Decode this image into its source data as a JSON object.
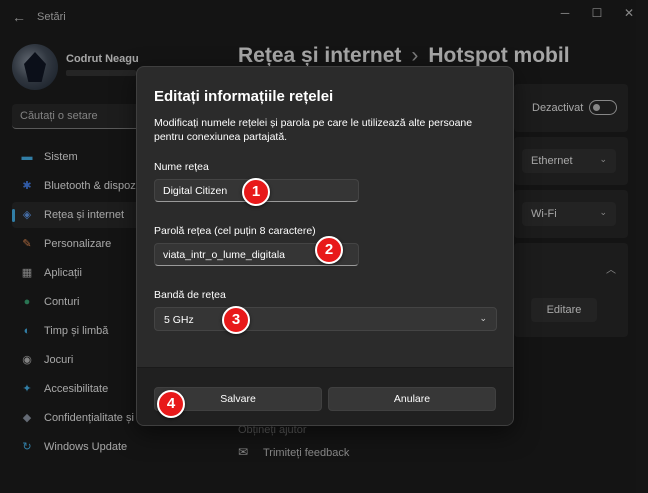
{
  "window": {
    "title": "Setări",
    "back_glyph": "←",
    "minimize_glyph": "─",
    "maximize_glyph": "☐",
    "close_glyph": "✕"
  },
  "profile": {
    "name": "Codrut Neagu"
  },
  "search": {
    "placeholder": "Căutați o setare"
  },
  "sidebar": {
    "items": [
      {
        "label": "Sistem",
        "icon": "monitor-icon",
        "glyph": "▬",
        "color": "#4cc2ff"
      },
      {
        "label": "Bluetooth & dispozi",
        "icon": "bluetooth-icon",
        "glyph": "✱",
        "color": "#4c8dff"
      },
      {
        "label": "Rețea și internet",
        "icon": "wifi-icon",
        "glyph": "◈",
        "color": "#6aa8ff",
        "active": true
      },
      {
        "label": "Personalizare",
        "icon": "brush-icon",
        "glyph": "✎",
        "color": "#ff9a5a"
      },
      {
        "label": "Aplicații",
        "icon": "apps-icon",
        "glyph": "▦",
        "color": "#c8c8c8"
      },
      {
        "label": "Conturi",
        "icon": "person-icon",
        "glyph": "●",
        "color": "#3fb27f"
      },
      {
        "label": "Timp și limbă",
        "icon": "globe-icon",
        "glyph": "◐",
        "color": "#4cc2ff"
      },
      {
        "label": "Jocuri",
        "icon": "gamepad-icon",
        "glyph": "◉",
        "color": "#c8c8c8"
      },
      {
        "label": "Accesibilitate",
        "icon": "accessibility-icon",
        "glyph": "✦",
        "color": "#4cc2ff"
      },
      {
        "label": "Confidențialitate și s",
        "icon": "shield-icon",
        "glyph": "◆",
        "color": "#9aa4b2"
      },
      {
        "label": "Windows Update",
        "icon": "update-icon",
        "glyph": "↻",
        "color": "#4cc2ff"
      }
    ]
  },
  "header": {
    "parent": "Rețea și internet",
    "separator": "›",
    "current": "Hotspot mobil"
  },
  "background": {
    "toggle_label": "Dezactivat",
    "share_from": "Ethernet",
    "share_over": "Wi-Fi",
    "edit_label": "Editare",
    "help_link": "Obțineți ajutor",
    "feedback_link": "Trimiteți feedback",
    "chevron_down_glyph": "⌄",
    "chevron_up_glyph": "︿",
    "feedback_glyph": "✉"
  },
  "dialog": {
    "title": "Editați informațiile rețelei",
    "description": "Modificați numele rețelei și parola pe care le utilizează alte persoane pentru conexiunea partajată.",
    "network_name_label": "Nume rețea",
    "network_name_value": "Digital Citizen",
    "password_label": "Parolă rețea (cel puțin 8 caractere)",
    "password_value": "viata_intr_o_lume_digitala",
    "band_label": "Bandă de rețea",
    "band_value": "5 GHz",
    "save_label": "Salvare",
    "cancel_label": "Anulare"
  },
  "markers": [
    "1",
    "2",
    "3",
    "4"
  ],
  "colors": {
    "accent": "#4cc2ff",
    "marker_red": "#e8191a",
    "background": "#202020",
    "dialog": "#2b2b2b"
  }
}
